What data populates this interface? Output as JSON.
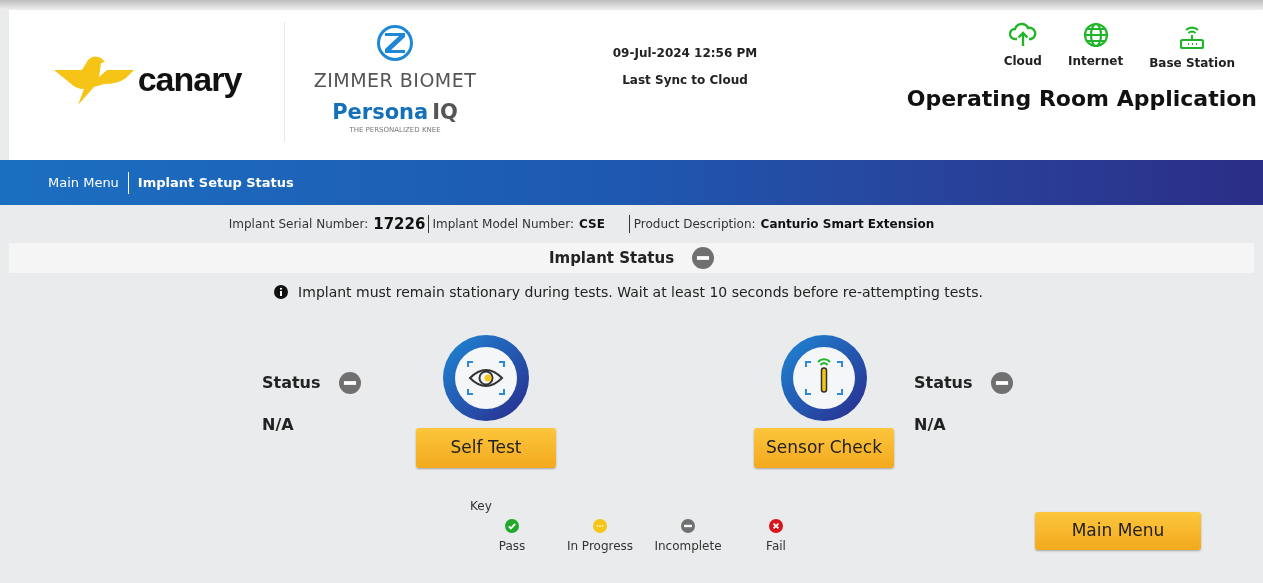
{
  "header": {
    "brand": "canary",
    "partner": "ZIMMER BIOMET",
    "product": "Persona",
    "product_suffix": "IQ",
    "product_tagline": "THE PERSONALIZED KNEE",
    "datetime": "09-Jul-2024 12:56 PM",
    "sync_label": "Last Sync to Cloud",
    "connections": [
      {
        "kind": "cloud",
        "label": "Cloud"
      },
      {
        "kind": "globe",
        "label": "Internet"
      },
      {
        "kind": "router",
        "label": "Base Station"
      }
    ],
    "app_title": "Operating Room Application"
  },
  "breadcrumb": [
    {
      "label": "Main Menu",
      "selected": false
    },
    {
      "label": "Implant Setup Status",
      "selected": true
    }
  ],
  "implant_info": [
    {
      "label": "Implant Serial Number:",
      "value": "17226"
    },
    {
      "label": "Implant Model Number:",
      "value": "CSE"
    },
    {
      "label": "Product Description:",
      "value": "Canturio Smart Extension"
    }
  ],
  "section": {
    "title": "Implant Status",
    "status_icon": {
      "kind": "incomplete"
    }
  },
  "notice": "Implant must remain stationary during tests. Wait at least 10 seconds before re-attempting tests.",
  "tests": [
    {
      "kind": "eye",
      "button": "Self Test",
      "status_label": "Status",
      "status_icon": {
        "kind": "incomplete"
      },
      "result": "N/A"
    },
    {
      "kind": "sensor",
      "button": "Sensor Check",
      "status_label": "Status",
      "status_icon": {
        "kind": "incomplete"
      },
      "result": "N/A"
    }
  ],
  "key": {
    "title": "Key",
    "items": [
      {
        "kind": "pass",
        "label": "Pass"
      },
      {
        "kind": "in_progress",
        "label": "In Progress"
      },
      {
        "kind": "incomplete",
        "label": "Incomplete"
      },
      {
        "kind": "fail",
        "label": "Fail"
      }
    ]
  },
  "footer_button": "Main Menu"
}
